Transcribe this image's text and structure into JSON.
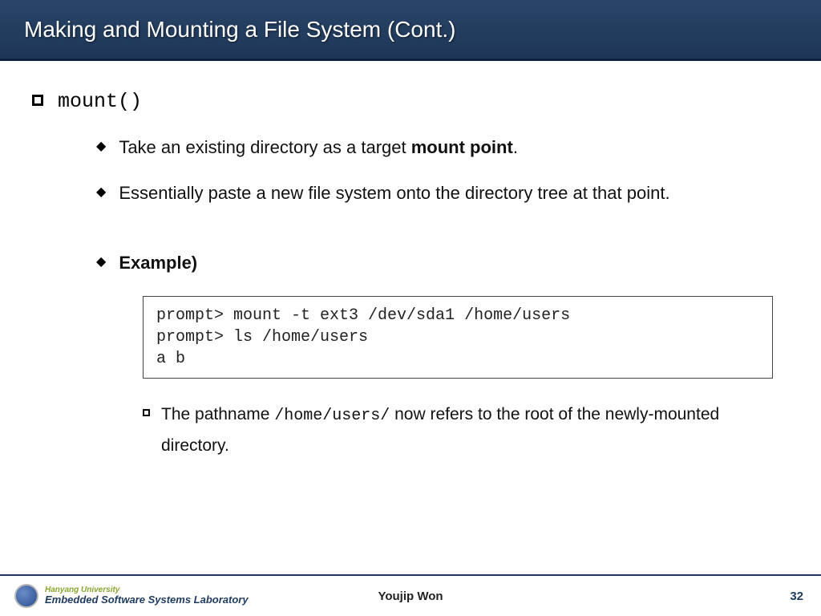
{
  "title": "Making and Mounting a File System (Cont.)",
  "main_bullet": "mount()",
  "points": {
    "p1_pre": "Take an existing directory as a target ",
    "p1_bold": "mount point",
    "p1_post": ".",
    "p2": "Essentially paste a new file system onto the directory tree at that point.",
    "example_label": "Example)"
  },
  "code": "prompt> mount -t ext3 /dev/sda1 /home/users\nprompt> ls /home/users\na b",
  "subpoint": {
    "pre": "The pathname ",
    "mono": "/home/users/",
    "post": " now refers to the root of the newly-mounted directory."
  },
  "footer": {
    "university": "Hanyang University",
    "lab": "Embedded Software Systems Laboratory",
    "author": "Youjip Won",
    "page": "32"
  }
}
